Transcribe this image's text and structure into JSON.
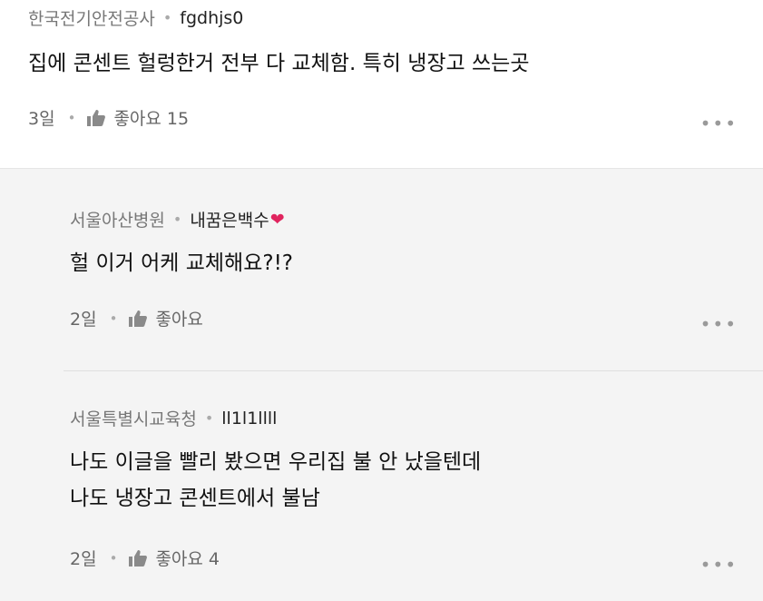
{
  "comments": [
    {
      "affiliation": "한국전기안전공사",
      "nickname": "fgdhjs0",
      "lines": [
        "집에 콘센트 헐렁한거 전부 다 교체함. 특히 냉장고 쓰는곳"
      ],
      "time": "3일",
      "like_label": "좋아요 15"
    }
  ],
  "replies": [
    {
      "affiliation": "서울아산병원",
      "nickname": "내꿈은백수",
      "nickname_emoji": "❤",
      "lines": [
        "헐 이거 어케 교체해요?!?"
      ],
      "time": "2일",
      "like_label": "좋아요"
    },
    {
      "affiliation": "서울특별시교육청",
      "nickname": "ll1l1llll",
      "lines": [
        "나도 이글을 빨리 봤으면 우리집 불 안 났을텐데",
        "나도 냉장고 콘센트에서 불남"
      ],
      "time": "2일",
      "like_label": "좋아요 4"
    }
  ],
  "ui": {
    "separator_dot": "•",
    "more_icon": "•••",
    "like_icon": "thumbs-up-icon"
  },
  "colors": {
    "reply_background": "#f4f4f4",
    "heart": "#e0245e",
    "muted_text": "#777777"
  }
}
